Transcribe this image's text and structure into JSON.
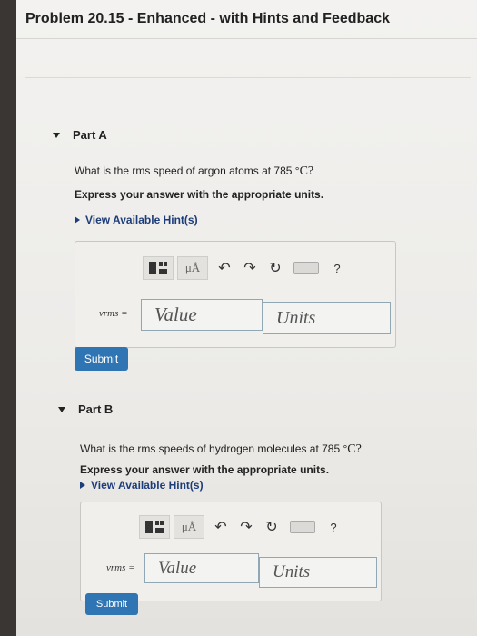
{
  "title": "Problem 20.15 - Enhanced - with Hints and Feedback",
  "toolbar": {
    "mu_label": "μÅ",
    "undo_icon": "undo-arrow",
    "redo_icon": "redo-arrow",
    "reset_icon": "reset-icon",
    "keyboard_icon": "keyboard-icon",
    "help_label": "?"
  },
  "partA": {
    "label": "Part A",
    "question": "What is the rms speed of argon atoms at 785 °",
    "question_unit": "C?",
    "instruction": "Express your answer with the appropriate units.",
    "hint_label": "View Available Hint(s)",
    "var_label": "vrms =",
    "value_placeholder": "Value",
    "units_placeholder": "Units",
    "submit_label": "Submit"
  },
  "partB": {
    "label": "Part B",
    "question": "What is the rms speeds of hydrogen molecules at 785 °",
    "question_unit": "C?",
    "instruction": "Express your answer with the appropriate units.",
    "hint_label": "View Available Hint(s)",
    "var_label": "vrms =",
    "value_placeholder": "Value",
    "units_placeholder": "Units",
    "submit_label": "Submit"
  }
}
